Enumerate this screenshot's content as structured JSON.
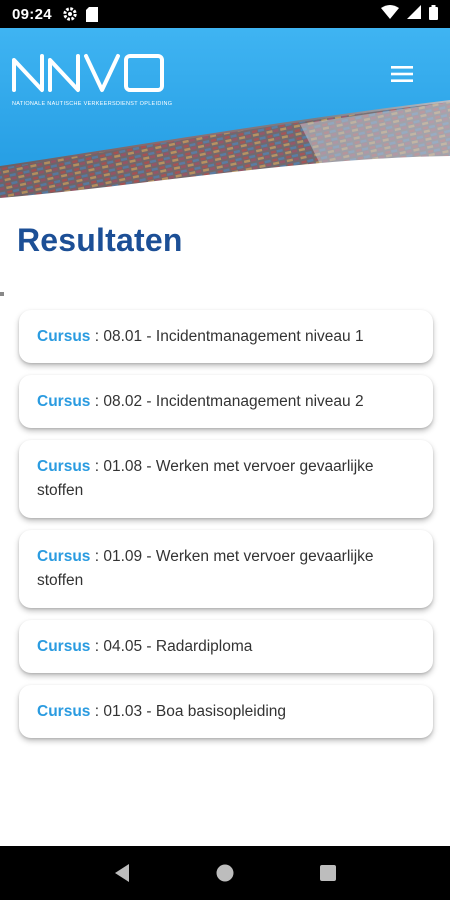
{
  "status_bar": {
    "time": "09:24"
  },
  "header": {
    "logo_text": "NNVO",
    "logo_subtitle": "NATIONALE NAUTISCHE VERKEERSDIENST OPLEIDING"
  },
  "page": {
    "title": "Resultaten"
  },
  "results": [
    {
      "label": "Cursus",
      "sep": " : ",
      "text": "08.01 - Incidentmanagement niveau 1"
    },
    {
      "label": "Cursus",
      "sep": " : ",
      "text": "08.02 - Incidentmanagement niveau 2"
    },
    {
      "label": "Cursus",
      "sep": " : ",
      "text": "01.08 - Werken met vervoer gevaarlijke stoffen"
    },
    {
      "label": "Cursus",
      "sep": " : ",
      "text": "01.09 - Werken met vervoer gevaarlijke stoffen"
    },
    {
      "label": "Cursus",
      "sep": " : ",
      "text": "04.05 - Radardiploma"
    },
    {
      "label": "Cursus",
      "sep": " : ",
      "text": "01.03 - Boa basisopleiding"
    }
  ],
  "colors": {
    "title": "#1c4f96",
    "accent": "#2a9be0",
    "header_blue": "#2aa6ea"
  }
}
